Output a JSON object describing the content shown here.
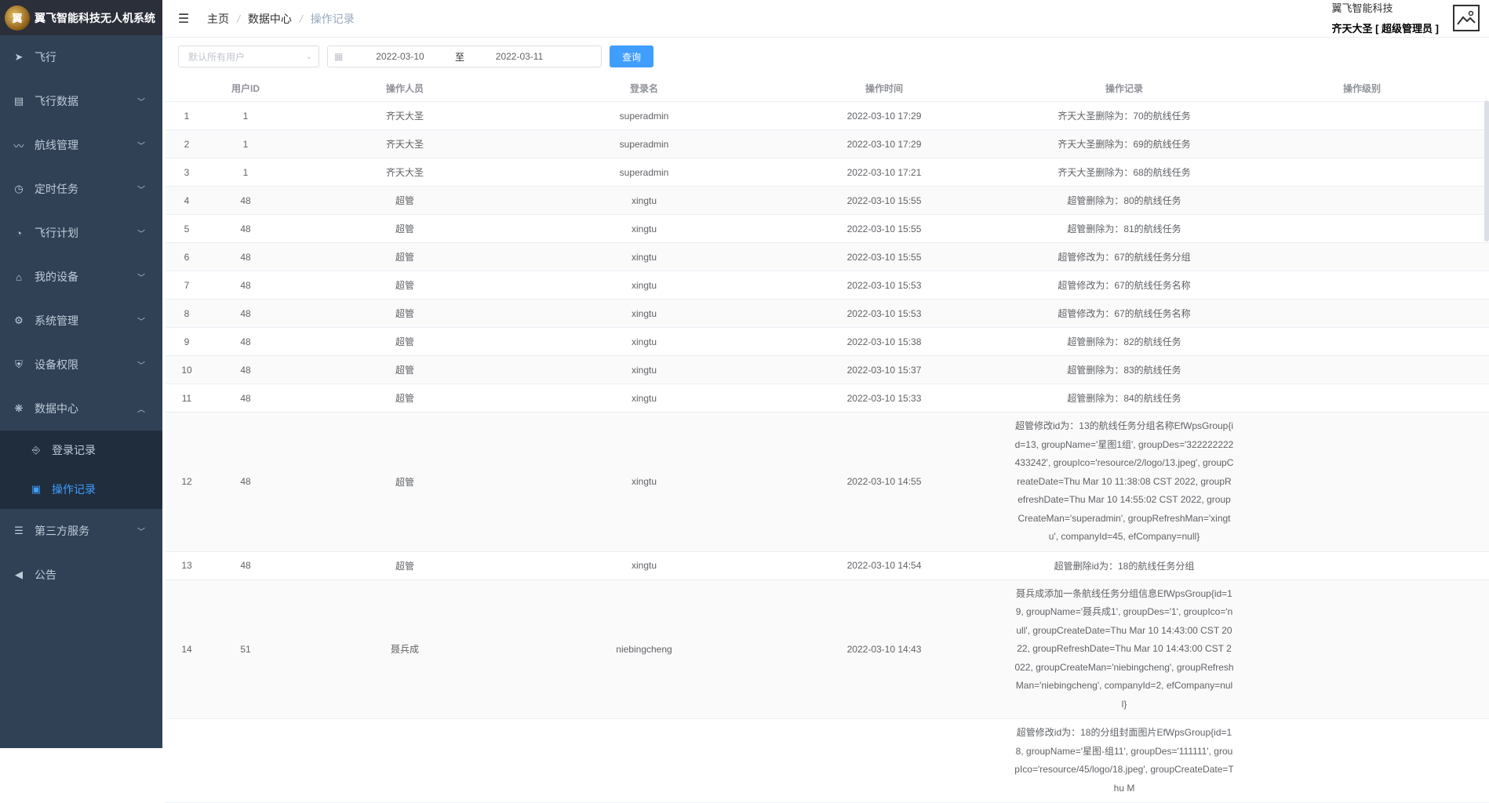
{
  "app": {
    "title": "翼飞智能科技无人机系统",
    "logo_text": "翼"
  },
  "sidebar": {
    "items": [
      {
        "label": "飞行",
        "icon": "send-icon",
        "glyph": "➤",
        "has_arrow": false
      },
      {
        "label": "飞行数据",
        "icon": "table-icon",
        "glyph": "▤",
        "has_arrow": true
      },
      {
        "label": "航线管理",
        "icon": "chart-line-icon",
        "glyph": "〰",
        "has_arrow": true
      },
      {
        "label": "定时任务",
        "icon": "clock-icon",
        "glyph": "◷",
        "has_arrow": true
      },
      {
        "label": "飞行计划",
        "icon": "dashboard-icon",
        "glyph": "◔",
        "has_arrow": true
      },
      {
        "label": "我的设备",
        "icon": "device-icon",
        "glyph": "⌂",
        "has_arrow": true
      },
      {
        "label": "系统管理",
        "icon": "gear-icon",
        "glyph": "⚙",
        "has_arrow": true
      },
      {
        "label": "设备权限",
        "icon": "shield-icon",
        "glyph": "⛨",
        "has_arrow": true
      },
      {
        "label": "数据中心",
        "icon": "setting-icon",
        "glyph": "❋",
        "has_arrow": true,
        "expanded": true
      }
    ],
    "sub_items": [
      {
        "label": "登录记录",
        "icon": "login-icon",
        "glyph": "⎆"
      },
      {
        "label": "操作记录",
        "icon": "document-icon",
        "glyph": "▣",
        "active": true
      }
    ],
    "items_after": [
      {
        "label": "第三方服务",
        "icon": "list-icon",
        "glyph": "☰",
        "has_arrow": true
      },
      {
        "label": "公告",
        "icon": "speaker-icon",
        "glyph": "◀",
        "has_arrow": false
      }
    ]
  },
  "breadcrumb": [
    "主页",
    "数据中心",
    "操作记录"
  ],
  "user": {
    "company": "翼飞智能科技",
    "name": "齐天大圣 [ 超级管理员 ]"
  },
  "filter": {
    "user_placeholder": "默认所有用户",
    "start_date": "2022-03-10",
    "range_sep": "至",
    "end_date": "2022-03-11",
    "query_label": "查询"
  },
  "table": {
    "columns": [
      "",
      "用户ID",
      "操作人员",
      "登录名",
      "操作时间",
      "操作记录",
      "操作级别"
    ],
    "rows": [
      {
        "idx": "1",
        "uid": "1",
        "operator": "齐天大圣",
        "login": "superadmin",
        "time": "2022-03-10 17:29",
        "record": "齐天大圣删除为：70的航线任务",
        "level": ""
      },
      {
        "idx": "2",
        "uid": "1",
        "operator": "齐天大圣",
        "login": "superadmin",
        "time": "2022-03-10 17:29",
        "record": "齐天大圣删除为：69的航线任务",
        "level": ""
      },
      {
        "idx": "3",
        "uid": "1",
        "operator": "齐天大圣",
        "login": "superadmin",
        "time": "2022-03-10 17:21",
        "record": "齐天大圣删除为：68的航线任务",
        "level": ""
      },
      {
        "idx": "4",
        "uid": "48",
        "operator": "超管",
        "login": "xingtu",
        "time": "2022-03-10 15:55",
        "record": "超管删除为：80的航线任务",
        "level": ""
      },
      {
        "idx": "5",
        "uid": "48",
        "operator": "超管",
        "login": "xingtu",
        "time": "2022-03-10 15:55",
        "record": "超管删除为：81的航线任务",
        "level": ""
      },
      {
        "idx": "6",
        "uid": "48",
        "operator": "超管",
        "login": "xingtu",
        "time": "2022-03-10 15:55",
        "record": "超管修改为：67的航线任务分组",
        "level": ""
      },
      {
        "idx": "7",
        "uid": "48",
        "operator": "超管",
        "login": "xingtu",
        "time": "2022-03-10 15:53",
        "record": "超管修改为：67的航线任务名称",
        "level": ""
      },
      {
        "idx": "8",
        "uid": "48",
        "operator": "超管",
        "login": "xingtu",
        "time": "2022-03-10 15:53",
        "record": "超管修改为：67的航线任务名称",
        "level": ""
      },
      {
        "idx": "9",
        "uid": "48",
        "operator": "超管",
        "login": "xingtu",
        "time": "2022-03-10 15:38",
        "record": "超管删除为：82的航线任务",
        "level": ""
      },
      {
        "idx": "10",
        "uid": "48",
        "operator": "超管",
        "login": "xingtu",
        "time": "2022-03-10 15:37",
        "record": "超管删除为：83的航线任务",
        "level": ""
      },
      {
        "idx": "11",
        "uid": "48",
        "operator": "超管",
        "login": "xingtu",
        "time": "2022-03-10 15:33",
        "record": "超管删除为：84的航线任务",
        "level": ""
      },
      {
        "idx": "12",
        "uid": "48",
        "operator": "超管",
        "login": "xingtu",
        "time": "2022-03-10 14:55",
        "record": "超管修改id为：13的航线任务分组名称EfWpsGroup{id=13, groupName='星图1组', groupDes='322222222433242', groupIco='resource/2/logo/13.jpeg', groupCreateDate=Thu Mar 10 11:38:08 CST 2022, groupRefreshDate=Thu Mar 10 14:55:02 CST 2022, groupCreateMan='superadmin', groupRefreshMan='xingtu', companyId=45, efCompany=null}",
        "level": ""
      },
      {
        "idx": "13",
        "uid": "48",
        "operator": "超管",
        "login": "xingtu",
        "time": "2022-03-10 14:54",
        "record": "超管删除id为：18的航线任务分组",
        "level": ""
      },
      {
        "idx": "14",
        "uid": "51",
        "operator": "聂兵成",
        "login": "niebingcheng",
        "time": "2022-03-10 14:43",
        "record": "聂兵成添加一条航线任务分组信息EfWpsGroup{id=19, groupName='聂兵成1', groupDes='1', groupIco='null', groupCreateDate=Thu Mar 10 14:43:00 CST 2022, groupRefreshDate=Thu Mar 10 14:43:00 CST 2022, groupCreateMan='niebingcheng', groupRefreshMan='niebingcheng', companyId=2, efCompany=null}",
        "level": ""
      },
      {
        "idx": "",
        "uid": "",
        "operator": "",
        "login": "",
        "time": "",
        "record": "超管修改id为：18的分组封面图片EfWpsGroup{id=18, groupName='星图-组11', groupDes='111111', groupIco='resource/45/logo/18.jpeg', groupCreateDate=Thu M",
        "level": ""
      }
    ]
  }
}
